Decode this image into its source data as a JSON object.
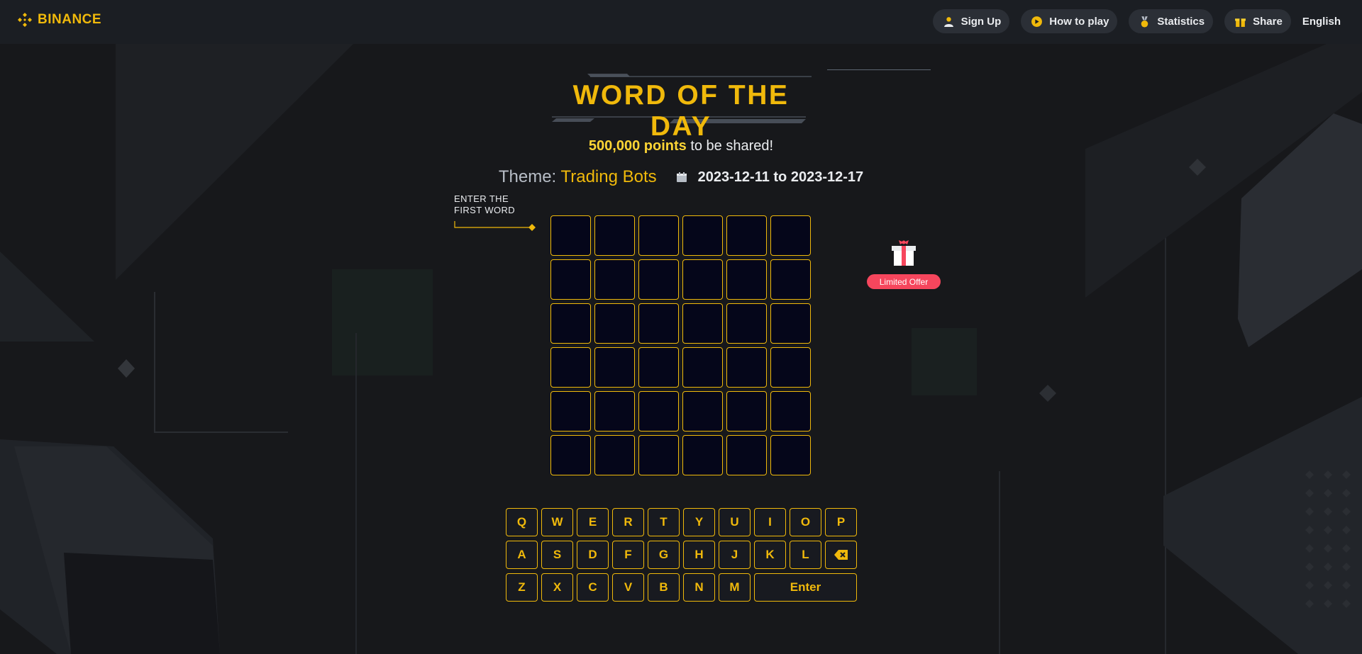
{
  "brand": {
    "name": "BINANCE",
    "color": "#f0b90b"
  },
  "nav": {
    "items": [
      {
        "label": "Sign Up",
        "icon": "user-icon"
      },
      {
        "label": "How to play",
        "icon": "play-icon"
      },
      {
        "label": "Statistics",
        "icon": "medal-icon"
      },
      {
        "label": "Share",
        "icon": "gift-icon"
      }
    ],
    "language": "English"
  },
  "header": {
    "title": "WORD OF THE DAY",
    "prize_amount": "500,000 points",
    "prize_suffix": " to be shared!",
    "theme_label": "Theme: ",
    "theme_value": "Trading Bots",
    "date_range": "2023-12-11 to 2023-12-17"
  },
  "hint": {
    "line1": "ENTER THE",
    "line2": "FIRST WORD"
  },
  "board": {
    "rows": 6,
    "cols": 6,
    "cells": [
      [
        "",
        "",
        "",
        "",
        "",
        ""
      ],
      [
        "",
        "",
        "",
        "",
        "",
        ""
      ],
      [
        "",
        "",
        "",
        "",
        "",
        ""
      ],
      [
        "",
        "",
        "",
        "",
        "",
        ""
      ],
      [
        "",
        "",
        "",
        "",
        "",
        ""
      ],
      [
        "",
        "",
        "",
        "",
        "",
        ""
      ]
    ]
  },
  "promo": {
    "badge": "Limited Offer",
    "icon": "gift-box-icon"
  },
  "keyboard": {
    "row1": [
      "Q",
      "W",
      "E",
      "R",
      "T",
      "Y",
      "U",
      "I",
      "O",
      "P"
    ],
    "row2": [
      "A",
      "S",
      "D",
      "F",
      "G",
      "H",
      "J",
      "K",
      "L"
    ],
    "row3": [
      "Z",
      "X",
      "C",
      "V",
      "B",
      "N",
      "M"
    ],
    "backspace_icon": "backspace-icon",
    "enter_label": "Enter"
  },
  "colors": {
    "accent": "#f0b90b",
    "background": "#17181b",
    "cell_bg": "#05061a",
    "badge": "#f6465d"
  }
}
